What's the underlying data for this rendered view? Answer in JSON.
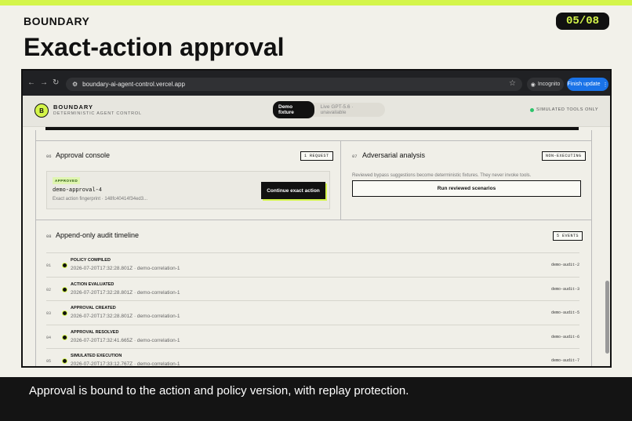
{
  "slide": {
    "brand": "BOUNDARY",
    "page": "05/08",
    "title": "Exact-action approval",
    "caption": "Approval is bound to the action and policy version, with replay protection."
  },
  "browser": {
    "url": "boundary-ai-agent-control.vercel.app",
    "incognito": "Incognito",
    "finish_update": "Finish update"
  },
  "app": {
    "logo": "B",
    "name": "BOUNDARY",
    "subtitle": "DETERMINISTIC AGENT CONTROL",
    "mode_active": "Demo fixture",
    "mode_inactive": "Live GPT-5.6 · unavailable",
    "status": "SIMULATED TOOLS ONLY"
  },
  "approval_console": {
    "num": "06",
    "title": "Approval console",
    "tag": "1 REQUEST",
    "card": {
      "status": "APPROVED",
      "id": "demo-approval-4",
      "fingerprint": "Exact action fingerprint · 148fc40414f34ed3...",
      "button": "Continue exact action"
    }
  },
  "adversarial": {
    "num": "07",
    "title": "Adversarial analysis",
    "tag": "NON-EXECUTING",
    "text": "Reviewed bypass suggestions become deterministic fixtures. They never invoke tools.",
    "button": "Run reviewed scenarios"
  },
  "timeline": {
    "num": "08",
    "title": "Append-only audit timeline",
    "tag": "5 EVENTS",
    "rows": [
      {
        "n": "01",
        "label": "POLICY COMPILED",
        "sub": "2026-07-20T17:32:28.801Z · demo-correlation-1",
        "audit": "demo-audit-2"
      },
      {
        "n": "02",
        "label": "ACTION EVALUATED",
        "sub": "2026-07-20T17:32:28.801Z · demo-correlation-1",
        "audit": "demo-audit-3"
      },
      {
        "n": "03",
        "label": "APPROVAL CREATED",
        "sub": "2026-07-20T17:32:28.801Z · demo-correlation-1",
        "audit": "demo-audit-5"
      },
      {
        "n": "04",
        "label": "APPROVAL RESOLVED",
        "sub": "2026-07-20T17:32:41.665Z · demo-correlation-1",
        "audit": "demo-audit-6"
      },
      {
        "n": "05",
        "label": "SIMULATED EXECUTION",
        "sub": "2026-07-20T17:33:12.767Z · demo-correlation-1",
        "audit": "demo-audit-7"
      }
    ]
  }
}
